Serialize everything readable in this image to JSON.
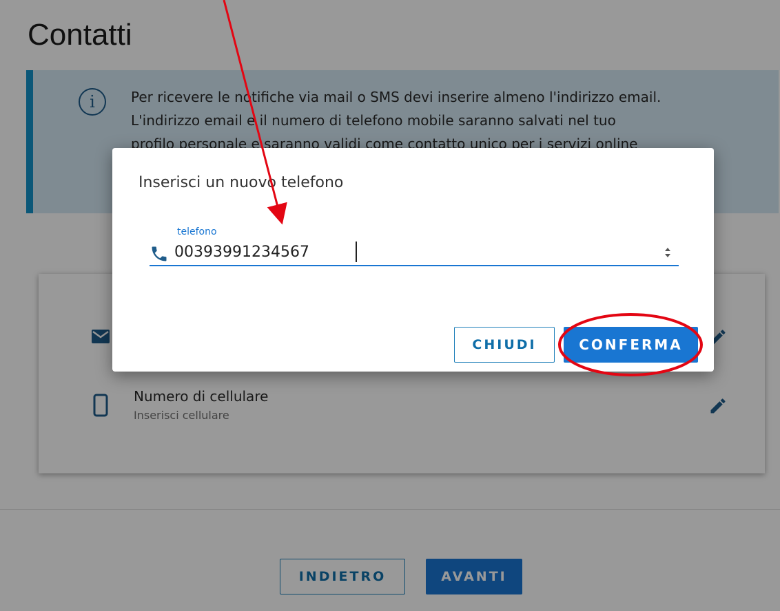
{
  "page": {
    "title": "Contatti",
    "info": {
      "lines": [
        "Per ricevere le notifiche via mail o SMS devi inserire almeno l'indirizzo email.",
        "L'indirizzo email e il numero di telefono mobile saranno salvati nel tuo",
        "profilo personale e saranno validi come contatto unico per i servizi online"
      ]
    },
    "contacts": {
      "mobile": {
        "label": "Numero di cellulare",
        "placeholder": "Inserisci cellulare"
      }
    },
    "nav": {
      "back_label": "INDIETRO",
      "next_label": "AVANTI"
    }
  },
  "dialog": {
    "title": "Inserisci un nuovo telefono",
    "phone_field": {
      "label": "telefono",
      "value": "00393991234567"
    },
    "close_label": "CHIUDI",
    "confirm_label": "CONFERMA"
  },
  "colors": {
    "primary": "#1976d2",
    "info_bg": "#d4e8f4",
    "info_border": "#1392c9",
    "annotation": "#e30613"
  },
  "icons": [
    "info-icon",
    "email-icon",
    "mobile-icon",
    "edit-icon",
    "phone-icon",
    "spinner-icon"
  ]
}
